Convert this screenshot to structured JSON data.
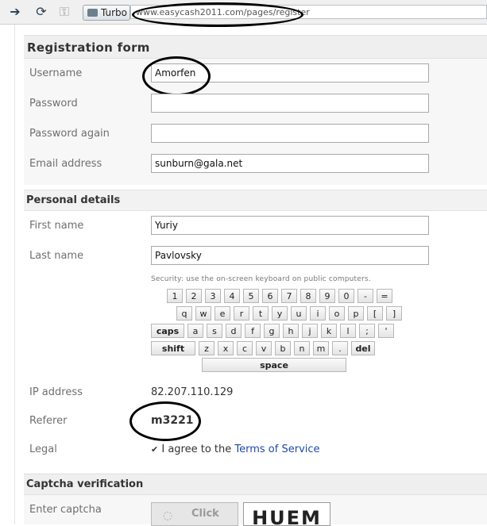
{
  "browser": {
    "turbo_label": "Turbo",
    "url": "www.easycash2011.com/pages/register"
  },
  "registration": {
    "title": "Registration form",
    "username_label": "Username",
    "username_value": "Amorfen",
    "password_label": "Password",
    "password_value": "",
    "password_again_label": "Password again",
    "password_again_value": "",
    "email_label": "Email address",
    "email_value": "sunburn@gala.net"
  },
  "personal": {
    "title": "Personal details",
    "first_name_label": "First name",
    "first_name_value": "Yuriy",
    "last_name_label": "Last name",
    "last_name_value": "Pavlovsky"
  },
  "keyboard": {
    "note": "Security: use the on-screen keyboard on public computers.",
    "rows": [
      [
        "1",
        "2",
        "3",
        "4",
        "5",
        "6",
        "7",
        "8",
        "9",
        "0",
        "-",
        "="
      ],
      [
        "q",
        "w",
        "e",
        "r",
        "t",
        "y",
        "u",
        "i",
        "o",
        "p",
        "[",
        "]"
      ],
      [
        "caps",
        "a",
        "s",
        "d",
        "f",
        "g",
        "h",
        "j",
        "k",
        "l",
        ";",
        "'"
      ],
      [
        "shift",
        "z",
        "x",
        "c",
        "v",
        "b",
        "n",
        "m",
        ".",
        "del"
      ]
    ],
    "space": "space"
  },
  "info": {
    "ip_label": "IP address",
    "ip_value": "82.207.110.129",
    "referer_label": "Referer",
    "referer_value": "m3221",
    "legal_label": "Legal",
    "legal_text": "I agree to the ",
    "legal_link": "Terms of Service"
  },
  "captcha": {
    "title": "Captcha verification",
    "label": "Enter captcha",
    "click_text": "Click",
    "code": "HUEM"
  }
}
